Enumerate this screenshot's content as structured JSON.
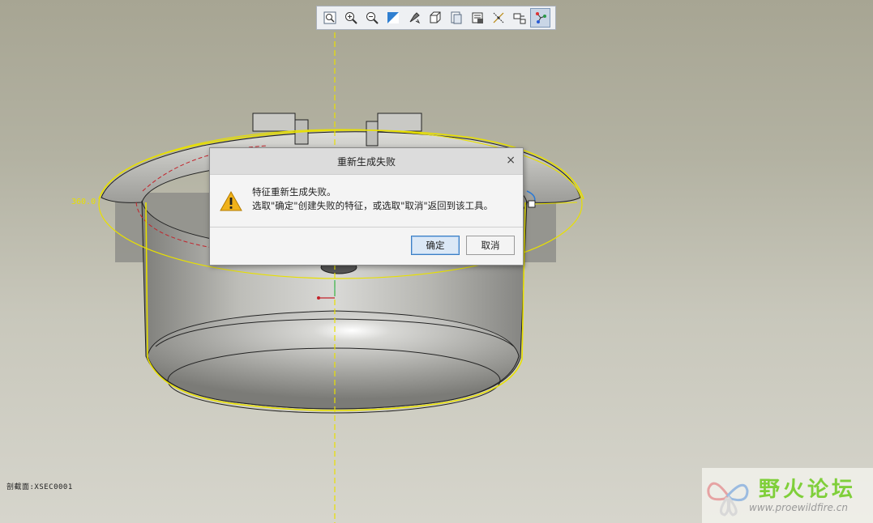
{
  "toolbar": {
    "icons": [
      "zoom-fit-icon",
      "zoom-in-icon",
      "zoom-out-icon",
      "repaint-icon",
      "orient-icon",
      "display-style-icon",
      "saved-views-icon",
      "layers-icon",
      "datum-display-icon",
      "annotation-display-icon",
      "spin-center-icon"
    ]
  },
  "dialog": {
    "title": "重新生成失败",
    "close": "×",
    "line1": "特征重新生成失败。",
    "line2": "选取\"确定\"创建失败的特征，或选取\"取消\"返回到该工具。",
    "ok_label": "确定",
    "cancel_label": "取消"
  },
  "viewport": {
    "dimension_label": "360.0",
    "status_text": "剖截面:XSEC0001"
  },
  "watermark": {
    "title": "野火论坛",
    "url": "www.proewildfire.cn"
  },
  "colors": {
    "selection": "#e8e000",
    "dialog_ok_border": "#3c7fc4"
  }
}
